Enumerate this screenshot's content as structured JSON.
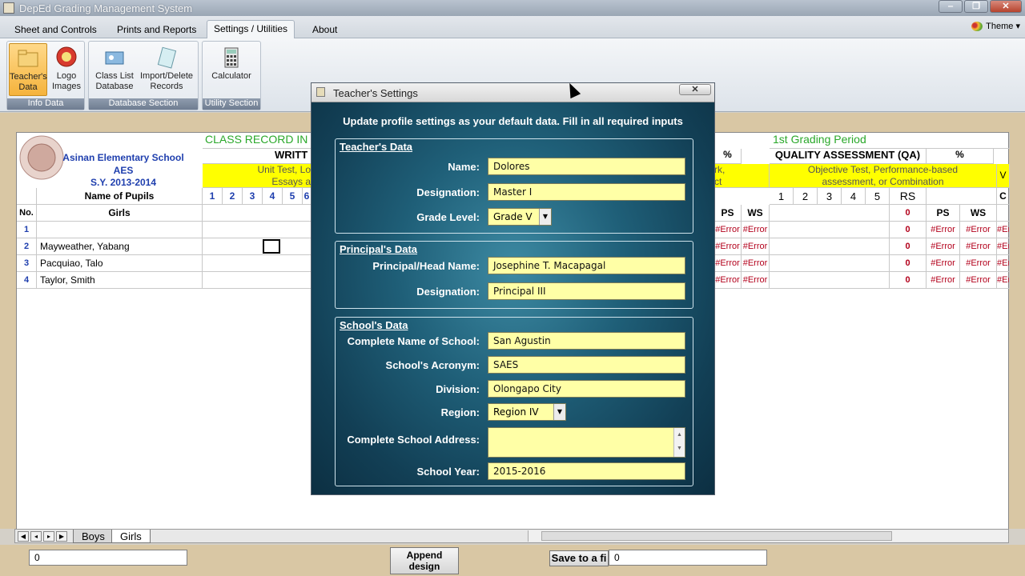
{
  "window": {
    "title": "DepEd Grading Management System",
    "minimize": "‒",
    "maximize": "❐",
    "close": "✕"
  },
  "menu": {
    "tabs": [
      "Sheet and Controls",
      "Prints and Reports",
      "Settings / Utilities",
      "About"
    ],
    "theme": "Theme ▾"
  },
  "ribbon": {
    "groups": [
      {
        "label": "Info Data",
        "buttons": [
          "Teacher's Data",
          "Logo Images"
        ]
      },
      {
        "label": "Database Section",
        "buttons": [
          "Class List Database",
          "Import/Delete Records"
        ]
      },
      {
        "label": "Utility Section",
        "buttons": [
          "Calculator"
        ]
      }
    ]
  },
  "sheet": {
    "school_name": "Asinan Elementary School",
    "school_acronym": "AES",
    "school_year": "S.Y. 2013-2014",
    "class_record": "CLASS RECORD IN",
    "written": "WRITT",
    "written_desc_1": "Unit Test, Lo",
    "written_desc_2": "Essays a",
    "name_of_pupils": "Name of Pupils",
    "no_label": "No.",
    "girls_label": "Girls",
    "columns": [
      "1",
      "2",
      "3",
      "4",
      "5",
      "6"
    ],
    "grading_period": "1st Grading Period",
    "pct": "%",
    "qa_title": "QUALITY ASSESSMENT (QA)",
    "qa_desc_1": "Objective Test, Performance-based",
    "qa_desc_2": "assessment, or Combination",
    "mid_desc_1": "rk,",
    "mid_desc_2": "ct",
    "rs": "RS",
    "ps": "PS",
    "ws": "WS",
    "zero": "0",
    "v_label": "V",
    "c_label": "C",
    "error": "#Error",
    "rows": [
      {
        "no": "1",
        "name": ""
      },
      {
        "no": "2",
        "name": "Mayweather, Yabang"
      },
      {
        "no": "3",
        "name": "Pacquiao, Talo"
      },
      {
        "no": "4",
        "name": "Taylor, Smith"
      }
    ]
  },
  "tabs": {
    "boys": "Boys",
    "girls": "Girls"
  },
  "bottom": {
    "field_left": "0",
    "append": "Append design",
    "save": "Save to a fi",
    "field_right": "0"
  },
  "dialog": {
    "title": "Teacher's Settings",
    "close": "✕",
    "heading": "Update profile settings as your default data. Fill in all required inputs",
    "teacher": {
      "title": "Teacher's Data",
      "name_label": "Name:",
      "name": "Dolores",
      "designation_label": "Designation:",
      "designation": "Master I",
      "grade_label": "Grade Level:",
      "grade": "Grade V"
    },
    "principal": {
      "title": "Principal's Data",
      "name_label": "Principal/Head Name:",
      "name": "Josephine T. Macapagal",
      "designation_label": "Designation:",
      "designation": "Principal III"
    },
    "school": {
      "title": "School's Data",
      "name_label": "Complete Name of School:",
      "name": "San Agustin",
      "acronym_label": "School's Acronym:",
      "acronym": "SAES",
      "division_label": "Division:",
      "division": "Olongapo City",
      "region_label": "Region:",
      "region": "Region IV",
      "address_label": "Complete School Address:",
      "address": "",
      "year_label": "School Year:",
      "year": "2015-2016"
    }
  }
}
